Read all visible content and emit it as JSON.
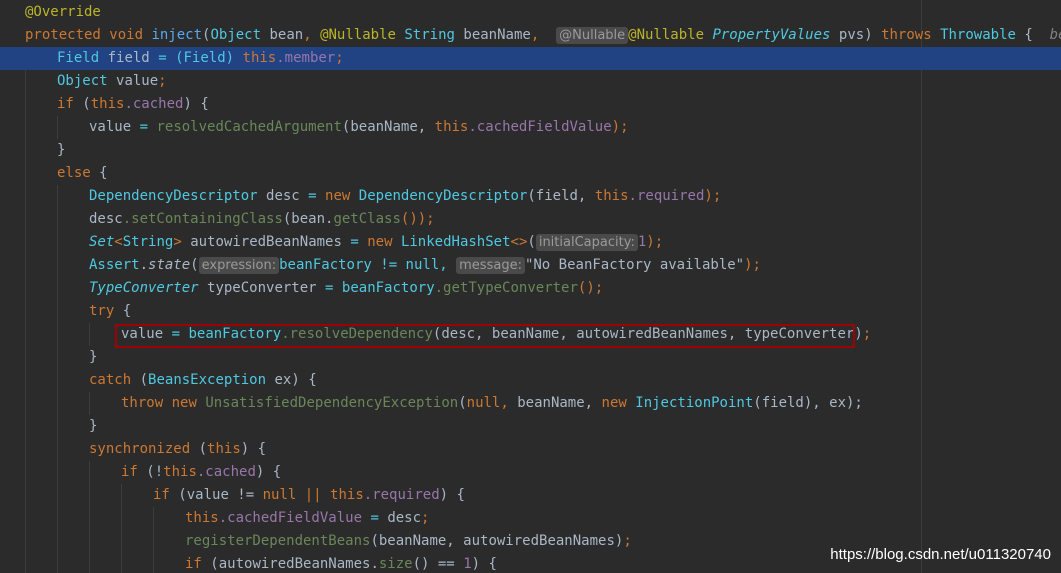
{
  "code": {
    "l0": {
      "annotation": "@Override"
    },
    "l1": {
      "protected": "protected",
      "void": "void",
      "method": "inject",
      "paren_open": "(",
      "type_object": "Object",
      "param_bean": "bean",
      "comma1": ",",
      "nullable_ann": "@Nullable",
      "type_string": "String",
      "param_beanName": "beanName",
      "comma2": ",",
      "hint_nullable": "@Nullable",
      "nullable_ann2": "@Nullable",
      "type_pv": "PropertyValues",
      "param_pvs": "pvs",
      "paren_close": ")",
      "throws": "throws",
      "throwable": "Throwable",
      "brace": "{",
      "hint_bean": "bean: "
    },
    "l2": {
      "type_field": "Field",
      "var_field": "field",
      "eq": "=",
      "cast": "(Field)",
      "this": "this",
      "dot_member": ".member",
      "semi": ";"
    },
    "l3": {
      "type_object": "Object",
      "var_value": "value",
      "semi": ";"
    },
    "l4": {
      "if": "if",
      "open": "(",
      "this": "this",
      "cached": ".cached",
      "close": ") {"
    },
    "l5": {
      "value": "value",
      "eq": "=",
      "call": "resolvedCachedArgument",
      "args_start": "(beanName,",
      "this": "this",
      "field": ".cachedFieldValue",
      "end": ");"
    },
    "l6": {
      "brace": "}"
    },
    "l7": {
      "else": "else",
      "brace": "{"
    },
    "l8": {
      "type": "DependencyDescriptor",
      "var": "desc",
      "eq": "=",
      "new": "new",
      "ctor": "DependencyDescriptor",
      "args": "(field,",
      "this": "this",
      "field": ".required",
      "end": ");"
    },
    "l9": {
      "var": "desc",
      "call": ".setContainingClass",
      "args_start": "(bean.",
      "getClass": "getClass",
      "end": "());"
    },
    "l10": {
      "type_set": "Set",
      "lt": "<",
      "type_string": "String",
      "gt": ">",
      "var": "autowiredBeanNames",
      "eq": "=",
      "new": "new",
      "ctor": "LinkedHashSet",
      "diamond": "<>",
      "open": "(",
      "hint": "initialCapacity:",
      "num": "1",
      "end": ");"
    },
    "l11": {
      "assert": "Assert",
      "dot": ".",
      "state": "state",
      "open": "(",
      "hint_expr": "expression:",
      "expr": "beanFactory != null,",
      "hint_msg": "message:",
      "msg": "\"No BeanFactory available\"",
      "end": ");"
    },
    "l12": {
      "type": "TypeConverter",
      "var": "typeConverter",
      "eq": "=",
      "obj": "beanFactory",
      "call": ".getTypeConverter",
      "end": "();"
    },
    "l13": {
      "try": "try",
      "brace": "{"
    },
    "l14": {
      "value": "value",
      "eq": "=",
      "obj": "beanFactory",
      "call": ".resolveDependency",
      "args": "(desc, beanName, autowiredBeanNames, typeConverter)",
      "semi": ";"
    },
    "l15": {
      "brace": "}"
    },
    "l16": {
      "catch": "catch",
      "open": "(",
      "type": "BeansException",
      "rest": "ex) {"
    },
    "l17": {
      "throw": "throw",
      "new": "new",
      "ctor": "UnsatisfiedDependencyException",
      "open": "(",
      "null": "null,",
      "mid": "beanName,",
      "new2": "new",
      "ctor2": "InjectionPoint",
      "end": "(field), ex);"
    },
    "l18": {
      "brace": "}"
    },
    "l19": {
      "sync": "synchronized",
      "open": "(",
      "this": "this",
      "close": ") {"
    },
    "l20": {
      "if": "if",
      "open": "(!",
      "this": "this",
      "cached": ".cached",
      "close": ") {"
    },
    "l21": {
      "if": "if",
      "start": "(value !=",
      "null": "null",
      "or": "||",
      "this": "this",
      "field": ".required",
      "close": ") {"
    },
    "l22": {
      "this": "this",
      "field": ".cachedFieldValue",
      "eq": "=",
      "rest": "desc",
      "semi": ";"
    },
    "l23": {
      "call": "registerDependentBeans",
      "args": "(beanName, autowiredBeanNames)",
      "semi": ";"
    },
    "l24": {
      "if": "if",
      "start": "(autowiredBeanNames.",
      "size": "size",
      "end": "() ==",
      "num": "1",
      "close": ") {"
    }
  },
  "watermark": "https://blog.csdn.net/u011320740",
  "colors": {
    "background": "#2b2b2b",
    "current_line": "#214283",
    "keyword": "#cc7832",
    "highlight_box": "#a00000"
  }
}
